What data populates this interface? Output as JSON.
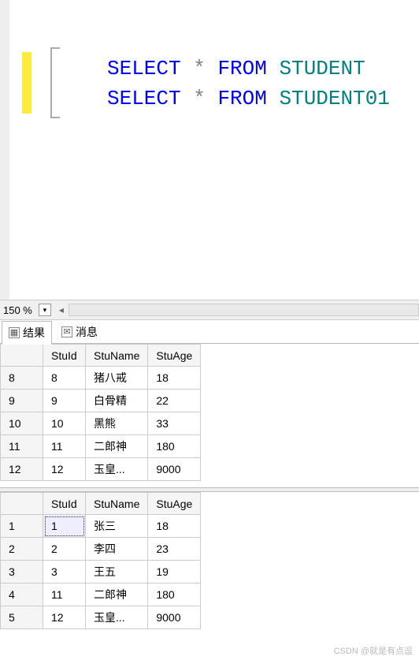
{
  "editor": {
    "lines": [
      {
        "tokens": [
          {
            "t": "SELECT",
            "c": "kw"
          },
          {
            "t": " ",
            "c": ""
          },
          {
            "t": "*",
            "c": "op"
          },
          {
            "t": " ",
            "c": ""
          },
          {
            "t": "FROM",
            "c": "kw"
          },
          {
            "t": " ",
            "c": ""
          },
          {
            "t": "STUDENT",
            "c": "ident"
          }
        ]
      },
      {
        "tokens": [
          {
            "t": "SELECT",
            "c": "kw"
          },
          {
            "t": " ",
            "c": ""
          },
          {
            "t": "*",
            "c": "op"
          },
          {
            "t": " ",
            "c": ""
          },
          {
            "t": "FROM",
            "c": "kw"
          },
          {
            "t": " ",
            "c": ""
          },
          {
            "t": "STUDENT01",
            "c": "ident"
          }
        ]
      }
    ]
  },
  "zoom": {
    "value": "150 %"
  },
  "tabs": {
    "results_label": "结果",
    "messages_label": "消息"
  },
  "grid1": {
    "columns": [
      "StuId",
      "StuName",
      "StuAge"
    ],
    "rows": [
      {
        "n": "8",
        "cells": [
          "8",
          "猪八戒",
          "18"
        ]
      },
      {
        "n": "9",
        "cells": [
          "9",
          "白骨精",
          "22"
        ]
      },
      {
        "n": "10",
        "cells": [
          "10",
          "黑熊",
          "33"
        ]
      },
      {
        "n": "11",
        "cells": [
          "11",
          "二郎神",
          "180"
        ]
      },
      {
        "n": "12",
        "cells": [
          "12",
          "玉皇...",
          "9000"
        ]
      }
    ]
  },
  "grid2": {
    "columns": [
      "StuId",
      "StuName",
      "StuAge"
    ],
    "selected": {
      "row": 0,
      "col": 0
    },
    "rows": [
      {
        "n": "1",
        "cells": [
          "1",
          "张三",
          "18"
        ]
      },
      {
        "n": "2",
        "cells": [
          "2",
          "李四",
          "23"
        ]
      },
      {
        "n": "3",
        "cells": [
          "3",
          "王五",
          "19"
        ]
      },
      {
        "n": "4",
        "cells": [
          "11",
          "二郎神",
          "180"
        ]
      },
      {
        "n": "5",
        "cells": [
          "12",
          "玉皇...",
          "9000"
        ]
      }
    ]
  },
  "watermark": "CSDN @就是有点逗"
}
